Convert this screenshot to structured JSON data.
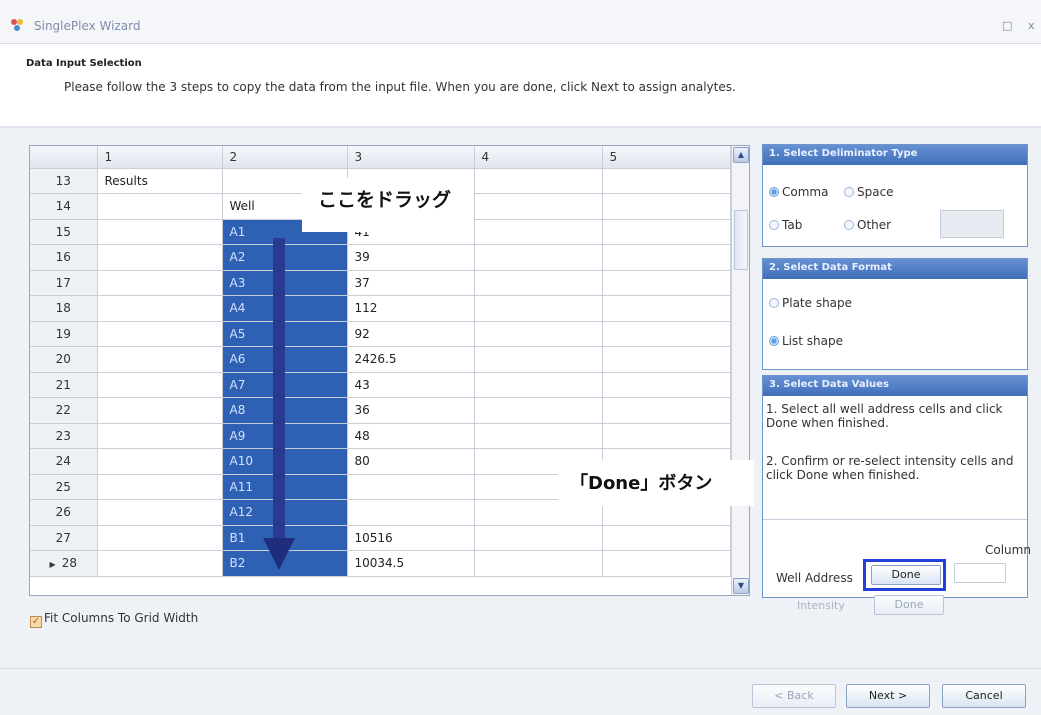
{
  "window": {
    "title": "SinglePlex Wizard",
    "maximize_glyph": "□",
    "close_glyph": "x"
  },
  "header": {
    "title": "Data Input Selection",
    "description": "Please follow the 3 steps to copy the data from the input file. When you are done, click Next to assign analytes."
  },
  "grid": {
    "columns": [
      "",
      "1",
      "2",
      "3",
      "4",
      "5"
    ],
    "rows": [
      {
        "n": "13",
        "c1": "Results",
        "c2": "",
        "c3": "",
        "sel": false
      },
      {
        "n": "14",
        "c1": "",
        "c2": "Well",
        "c3": "",
        "sel": false
      },
      {
        "n": "15",
        "c1": "",
        "c2": "A1",
        "c3": "41",
        "sel": true
      },
      {
        "n": "16",
        "c1": "",
        "c2": "A2",
        "c3": "39",
        "sel": true
      },
      {
        "n": "17",
        "c1": "",
        "c2": "A3",
        "c3": "37",
        "sel": true
      },
      {
        "n": "18",
        "c1": "",
        "c2": "A4",
        "c3": "112",
        "sel": true
      },
      {
        "n": "19",
        "c1": "",
        "c2": "A5",
        "c3": "92",
        "sel": true
      },
      {
        "n": "20",
        "c1": "",
        "c2": "A6",
        "c3": "2426.5",
        "sel": true
      },
      {
        "n": "21",
        "c1": "",
        "c2": "A7",
        "c3": "43",
        "sel": true
      },
      {
        "n": "22",
        "c1": "",
        "c2": "A8",
        "c3": "36",
        "sel": true
      },
      {
        "n": "23",
        "c1": "",
        "c2": "A9",
        "c3": "48",
        "sel": true
      },
      {
        "n": "24",
        "c1": "",
        "c2": "A10",
        "c3": "80",
        "sel": true
      },
      {
        "n": "25",
        "c1": "",
        "c2": "A11",
        "c3": "",
        "sel": true
      },
      {
        "n": "26",
        "c1": "",
        "c2": "A12",
        "c3": "",
        "sel": true
      },
      {
        "n": "27",
        "c1": "",
        "c2": "B1",
        "c3": "10516",
        "sel": true
      },
      {
        "n": "28",
        "c1": "",
        "c2": "B2",
        "c3": "10034.5",
        "sel": true,
        "current": true
      }
    ]
  },
  "annotations": {
    "drag_callout": "ここをドラッグ",
    "done_callout": "「Done」ボタン"
  },
  "delimiter_panel": {
    "title": "1. Select Deliminator Type",
    "options": {
      "comma": "Comma",
      "space": "Space",
      "tab": "Tab",
      "other": "Other"
    },
    "selected": "Comma"
  },
  "format_panel": {
    "title": "2. Select Data Format",
    "options": {
      "plate": "Plate shape",
      "list": "List shape"
    },
    "selected": "List shape"
  },
  "values_panel": {
    "title": "3. Select Data Values",
    "step1": "1. Select all well address cells and click Done when finished.",
    "step2": "2. Confirm or re-select intensity cells and click Done when finished.",
    "column_label": "Column",
    "well_address_label": "Well Address",
    "done_label": "Done",
    "intensity_label": "Intensity",
    "done2_label": "Done"
  },
  "options": {
    "fit_columns": "Fit Columns To Grid Width",
    "fit_columns_checked": true
  },
  "footer": {
    "back": "< Back",
    "next": "Next >",
    "cancel": "Cancel"
  },
  "colors": {
    "selection": "#2e61b4",
    "panel_header": "#4a78c2",
    "highlight_box": "#2440d8",
    "drag_arrow": "#2a3b8f"
  }
}
